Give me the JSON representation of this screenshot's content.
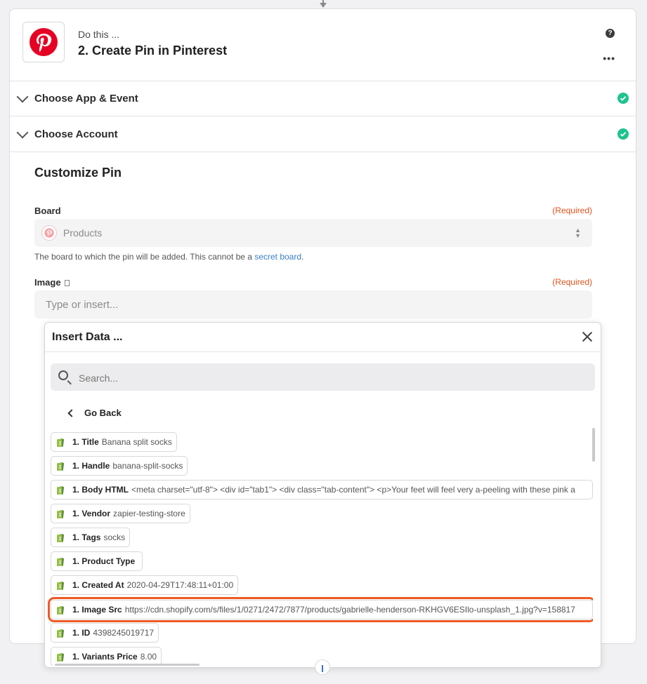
{
  "step": {
    "prefix": "Do this ...",
    "title": "2. Create Pin in Pinterest"
  },
  "sections": [
    {
      "label": "Choose App & Event",
      "complete": true
    },
    {
      "label": "Choose Account",
      "complete": true
    }
  ],
  "customize": {
    "title": "Customize Pin",
    "board": {
      "label": "Board",
      "required": "(Required)",
      "value": "Products",
      "hint_text": "The board to which the pin will be added. This cannot be a ",
      "hint_link": "secret board",
      "hint_end": "."
    },
    "image": {
      "label": "Image",
      "required": "(Required)",
      "placeholder": "Type or insert..."
    }
  },
  "insert_data": {
    "title": "Insert Data ...",
    "search_placeholder": "Search...",
    "go_back": "Go Back",
    "items": [
      {
        "key": "1. Title",
        "value": "Banana split socks"
      },
      {
        "key": "1. Handle",
        "value": "banana-split-socks"
      },
      {
        "key": "1. Body HTML",
        "value": "<meta charset=\"utf-8\"> <div id=\"tab1\"> <div class=\"tab-content\"> <p>Your feet will feel very a-peeling with these pink a"
      },
      {
        "key": "1. Vendor",
        "value": "zapier-testing-store"
      },
      {
        "key": "1. Tags",
        "value": "socks"
      },
      {
        "key": "1. Product Type",
        "value": ""
      },
      {
        "key": "1. Created At",
        "value": "2020-04-29T17:48:11+01:00"
      },
      {
        "key": "1. Image Src",
        "value": "https://cdn.shopify.com/s/files/1/0271/2472/7877/products/gabrielle-henderson-RKHGV6ESIlo-unsplash_1.jpg?v=158817",
        "highlighted": true
      },
      {
        "key": "1. ID",
        "value": "4398245019717"
      },
      {
        "key": "1. Variants Price",
        "value": "8.00"
      }
    ]
  },
  "colors": {
    "pinterest": "#e60023",
    "success": "#1ec38f",
    "required": "#e0521c",
    "highlight": "#ee5a24",
    "link": "#3a7fc8",
    "shopify": "#95bf47"
  }
}
